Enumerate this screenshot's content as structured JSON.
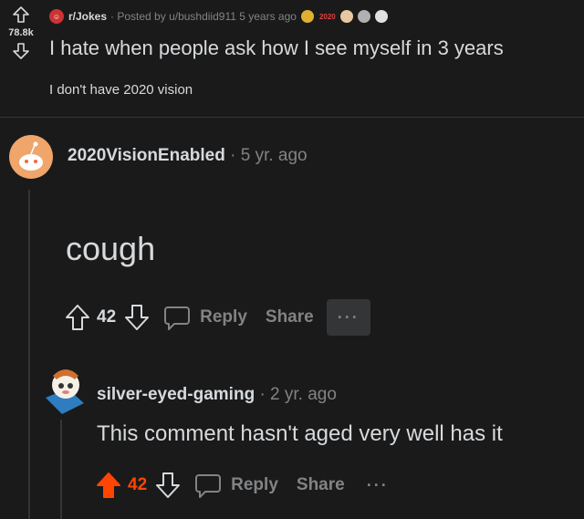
{
  "post": {
    "score": "78.8k",
    "subreddit": "r/Jokes",
    "posted_by": "· Posted by u/bushdiid911 5 years ago",
    "award_label": "2020",
    "title": "I hate when people ask how I see myself in 3 years",
    "body": "I don't have 2020 vision"
  },
  "comment1": {
    "author": "2020VisionEnabled",
    "time": " · 5 yr. ago",
    "text": "cough",
    "score": "42",
    "reply_label": "Reply",
    "share_label": "Share",
    "more_label": "···"
  },
  "comment2": {
    "author": "silver-eyed-gaming",
    "time": " · 2 yr. ago",
    "text": "This comment hasn't aged very well has it",
    "score": "42",
    "reply_label": "Reply",
    "share_label": "Share",
    "more_label": "···",
    "upvote_color": "#ff4500"
  }
}
